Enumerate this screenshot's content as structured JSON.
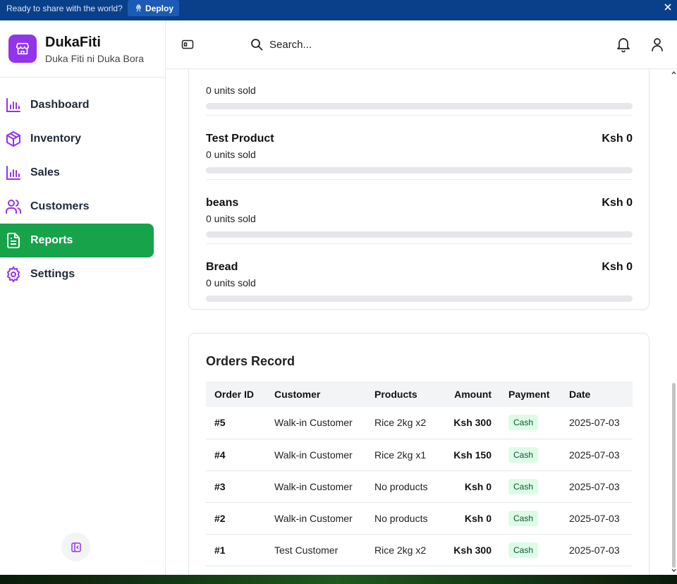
{
  "banner": {
    "text": "Ready to share with the world?",
    "deploy_label": "Deploy"
  },
  "brand": {
    "name": "DukaFiti",
    "tagline": "Duka Fiti ni Duka Bora",
    "accent": "#9333ea"
  },
  "sidebar": {
    "active_color": "#16a34a",
    "items": [
      {
        "label": "Dashboard",
        "icon": "bar-chart-icon"
      },
      {
        "label": "Inventory",
        "icon": "package-icon"
      },
      {
        "label": "Sales",
        "icon": "bar-chart-icon"
      },
      {
        "label": "Customers",
        "icon": "users-icon"
      },
      {
        "label": "Reports",
        "icon": "file-text-icon",
        "active": true
      },
      {
        "label": "Settings",
        "icon": "gear-icon"
      }
    ]
  },
  "header": {
    "search_placeholder": "Search..."
  },
  "top_products": [
    {
      "name": "",
      "units": "0 units sold",
      "amount": "",
      "progress": 0
    },
    {
      "name": "Test Product",
      "units": "0 units sold",
      "amount": "Ksh 0",
      "progress": 0
    },
    {
      "name": "beans",
      "units": "0 units sold",
      "amount": "Ksh 0",
      "progress": 0
    },
    {
      "name": "Bread",
      "units": "0 units sold",
      "amount": "Ksh 0",
      "progress": 0
    }
  ],
  "orders": {
    "title": "Orders Record",
    "columns": [
      "Order ID",
      "Customer",
      "Products",
      "Amount",
      "Payment",
      "Date"
    ],
    "rows": [
      {
        "id": "#5",
        "customer": "Walk-in Customer",
        "products": "Rice 2kg x2",
        "amount": "Ksh 300",
        "payment": "Cash",
        "date": "2025-07-03"
      },
      {
        "id": "#4",
        "customer": "Walk-in Customer",
        "products": "Rice 2kg x1",
        "amount": "Ksh 150",
        "payment": "Cash",
        "date": "2025-07-03"
      },
      {
        "id": "#3",
        "customer": "Walk-in Customer",
        "products": "No products",
        "amount": "Ksh 0",
        "payment": "Cash",
        "date": "2025-07-03"
      },
      {
        "id": "#2",
        "customer": "Walk-in Customer",
        "products": "No products",
        "amount": "Ksh 0",
        "payment": "Cash",
        "date": "2025-07-03"
      },
      {
        "id": "#1",
        "customer": "Test Customer",
        "products": "Rice 2kg x2",
        "amount": "Ksh 300",
        "payment": "Cash",
        "date": "2025-07-03"
      }
    ]
  }
}
